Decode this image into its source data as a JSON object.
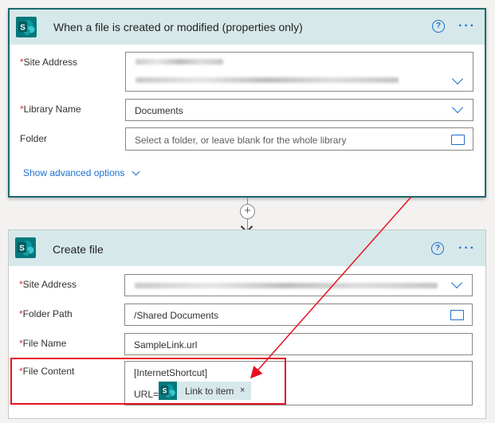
{
  "trigger": {
    "title": "When a file is created or modified (properties only)",
    "help_label": "?",
    "more_label": "···",
    "site_address_label": "Site Address",
    "library_name_label": "Library Name",
    "library_name_value": "Documents",
    "folder_label": "Folder",
    "folder_placeholder": "Select a folder, or leave blank for the whole library",
    "advanced_label": "Show advanced options"
  },
  "connector": {
    "plus_label": "+"
  },
  "create_file": {
    "title": "Create file",
    "help_label": "?",
    "more_label": "···",
    "site_address_label": "Site Address",
    "folder_path_label": "Folder Path",
    "folder_path_value": "/Shared Documents",
    "file_name_label": "File Name",
    "file_name_value": "SampleLink.url",
    "file_content_label": "File Content",
    "file_content_line1": "[InternetShortcut]",
    "file_content_prefix": "URL=",
    "token_label": "Link to item",
    "token_remove": "×"
  },
  "colors": {
    "header_bg": "#d7e8ea",
    "sharepoint_teal": "#03787c",
    "link_blue": "#1e6fcc",
    "required_red": "#d13438",
    "annotation_red": "#e81123",
    "selected_border": "#1b6b6e"
  },
  "icons": {
    "connector_icon": "sharepoint-icon",
    "dropdown_icon": "chevron-down-icon",
    "folder_picker_icon": "folder-icon"
  }
}
